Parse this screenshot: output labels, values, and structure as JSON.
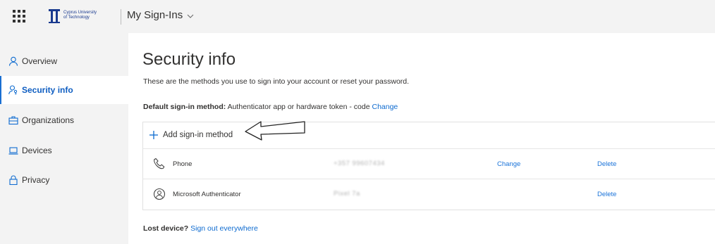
{
  "header": {
    "logo_text_line1": "Cyprus University",
    "logo_text_line2": "of Technology",
    "app_title": "My Sign-Ins"
  },
  "sidebar": {
    "items": [
      {
        "label": "Overview",
        "icon": "person-icon",
        "active": false
      },
      {
        "label": "Security info",
        "icon": "person-key-icon",
        "active": true
      },
      {
        "label": "Organizations",
        "icon": "briefcase-icon",
        "active": false
      },
      {
        "label": "Devices",
        "icon": "laptop-icon",
        "active": false
      },
      {
        "label": "Privacy",
        "icon": "lock-icon",
        "active": false
      }
    ]
  },
  "main": {
    "title": "Security info",
    "description": "These are the methods you use to sign into your account or reset your password.",
    "default_label": "Default sign-in method:",
    "default_value": "Authenticator app or hardware token - code",
    "default_change": "Change",
    "add_method": "Add sign-in method",
    "methods": [
      {
        "name": "Phone",
        "value": "+357 99607434",
        "change": "Change",
        "delete": "Delete",
        "icon": "phone-icon"
      },
      {
        "name": "Microsoft Authenticator",
        "value": "Pixel 7a",
        "delete": "Delete",
        "icon": "authenticator-icon"
      }
    ],
    "lost_label": "Lost device?",
    "lost_link": "Sign out everywhere"
  },
  "colors": {
    "accent": "#0e6bd0",
    "sidebar_bg": "#f3f3f3",
    "active_border": "#1a6fd1"
  }
}
